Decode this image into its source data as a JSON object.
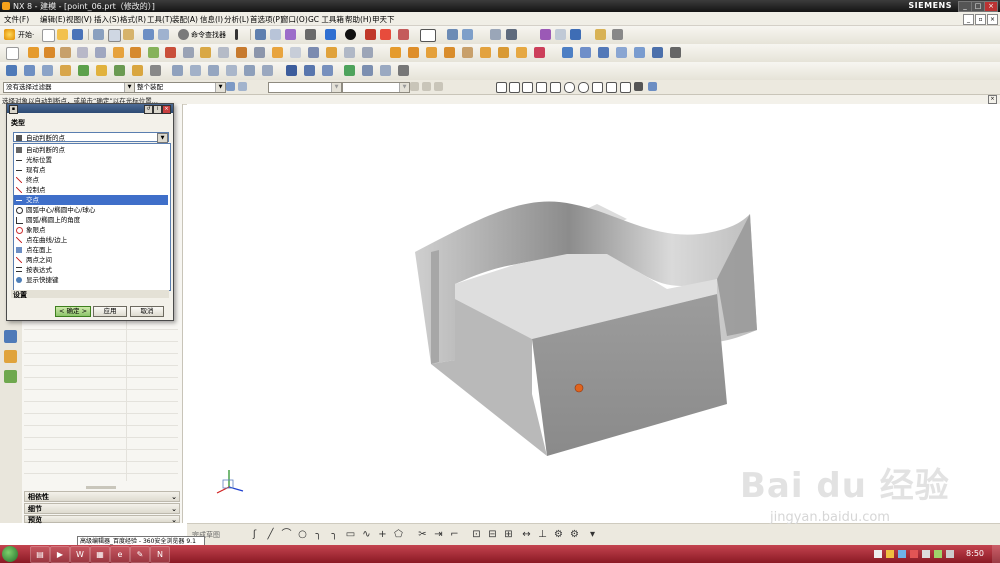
{
  "window": {
    "title": "NX 8 - 建模 - [point_06.prt（修改的）]",
    "brand": "SIEMENS"
  },
  "menubar": {
    "items": [
      "文件(F)",
      "编辑(E)",
      "视图(V)",
      "插入(S)",
      "格式(R)",
      "工具(T)",
      "装配(A)",
      "信息(I)",
      "分析(L)",
      "首选项(P)",
      "窗口(O)",
      "GC 工具箱",
      "帮助(H)",
      "甲天下"
    ]
  },
  "toolbar": {
    "start_label": "开始·",
    "command_finder_label": "命令查找器"
  },
  "filterbar": {
    "selection_filter": "没有选择过滤器",
    "assembly_scope": "整个装配"
  },
  "cue_line": "选择对象以自动判断点，或单击“确定”以在光标位置...",
  "dialog": {
    "section_type": "类型",
    "selected_type": "自动判断的点",
    "options": [
      "自动判断的点",
      "光标位置",
      "现有点",
      "终点",
      "控制点",
      "交点",
      "圆弧中心/椭圆中心/球心",
      "圆弧/椭圆上的角度",
      "象限点",
      "点在曲线/边上",
      "点在面上",
      "两点之间",
      "按表达式",
      "显示快捷键"
    ],
    "highlighted_index": 5,
    "section_settings": "设置",
    "ok": "< 确定 >",
    "apply": "应用",
    "cancel": "取消"
  },
  "navigator": {
    "sections": [
      "相依性",
      "细节",
      "预览"
    ]
  },
  "bottom_toolbar": {
    "sketch_label": "完成草图"
  },
  "taskbar": {
    "tooltip": "高级编辑器_百度经验 - 360安全浏览器 9.1",
    "clock": "8:50"
  },
  "watermark": {
    "brand": "Bai du 经验",
    "url": "jingyan.baidu.com"
  },
  "colors": {
    "accent": "#3f6fc9",
    "taskbar": "#a82a35",
    "ok_button": "#8cc46a"
  }
}
